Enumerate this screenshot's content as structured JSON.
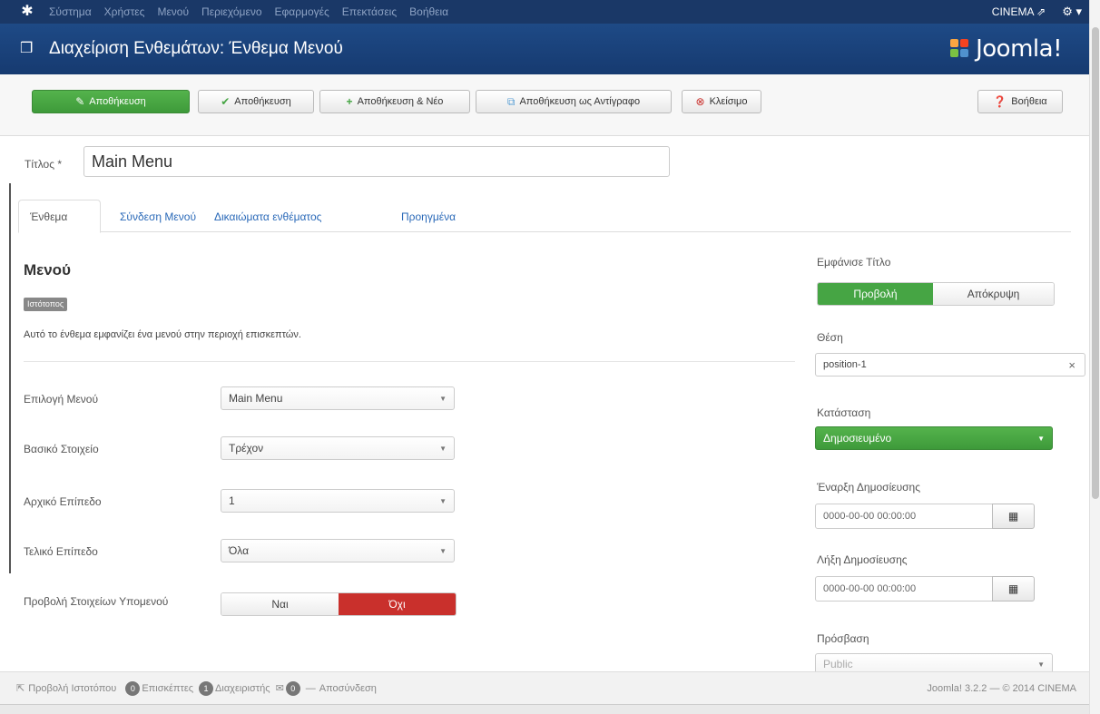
{
  "topnav": {
    "menu": [
      "Σύστημα",
      "Χρήστες",
      "Μενού",
      "Περιεχόμενο",
      "Εφαρμογές",
      "Επεκτάσεις",
      "Βοήθεια"
    ],
    "site": "CINEMA ⇗",
    "user_icon": "gear-icon"
  },
  "header": {
    "title": "Διαχείριση Ενθεμάτων: Ένθεμα Μενού",
    "brand": "Joomla!"
  },
  "toolbar": {
    "save": "Αποθήκευση",
    "save_close": "Αποθήκευση",
    "save_new": "Αποθήκευση & Νέο",
    "save_copy": "Αποθήκευση ως Αντίγραφο",
    "close": "Κλείσιμο",
    "help": "Βοήθεια"
  },
  "form": {
    "title_label": "Τίτλος *",
    "title_value": "Main Menu"
  },
  "tabs": [
    "Ένθεμα",
    "Σύνδεση Μενού",
    "Δικαιώματα ενθέματος",
    "Προηγμένα"
  ],
  "module": {
    "heading": "Μενού",
    "badge": "Ιστότοπος",
    "description": "Αυτό το ένθεμα εμφανίζει ένα μενού στην περιοχή επισκεπτών.",
    "fields": [
      {
        "label": "Επιλογή Μενού",
        "value": "Main Menu"
      },
      {
        "label": "Βασικό Στοιχείο",
        "value": "Τρέχον"
      },
      {
        "label": "Αρχικό Επίπεδο",
        "value": "1"
      },
      {
        "label": "Τελικό Επίπεδο",
        "value": "Όλα"
      }
    ],
    "submenu_label": "Προβολή Στοιχείων Υπομενού",
    "submenu_yes": "Ναι",
    "submenu_no": "Όχι"
  },
  "sidebar": {
    "show_title_label": "Εμφάνισε Τίτλο",
    "show": "Προβολή",
    "hide": "Απόκρυψη",
    "position_label": "Θέση",
    "position_value": "position-1",
    "position_clear": "×",
    "status_label": "Κατάσταση",
    "status_value": "Δημοσιευμένο",
    "publish_up_label": "Έναρξη Δημοσίευσης",
    "publish_up_value": "0000-00-00 00:00:00",
    "publish_down_label": "Λήξη Δημοσίευσης",
    "publish_down_value": "0000-00-00 00:00:00",
    "access_label": "Πρόσβαση",
    "access_value": "Public"
  },
  "footer": {
    "view_site": "Προβολή Ιστοτόπου",
    "visitors_count": "0",
    "visitors_label": "Επισκέπτες",
    "admins_count": "1",
    "admins_label": "Διαχειριστής",
    "messages_count": "0",
    "logout": "Αποσύνδεση",
    "version": "Joomla! 3.2.2 — © 2014 CINEMA"
  },
  "colors": {
    "nav": "#1a3867",
    "header": "#1e4a86",
    "green": "#46a544",
    "red": "#c9302c",
    "link": "#2a69b8"
  }
}
